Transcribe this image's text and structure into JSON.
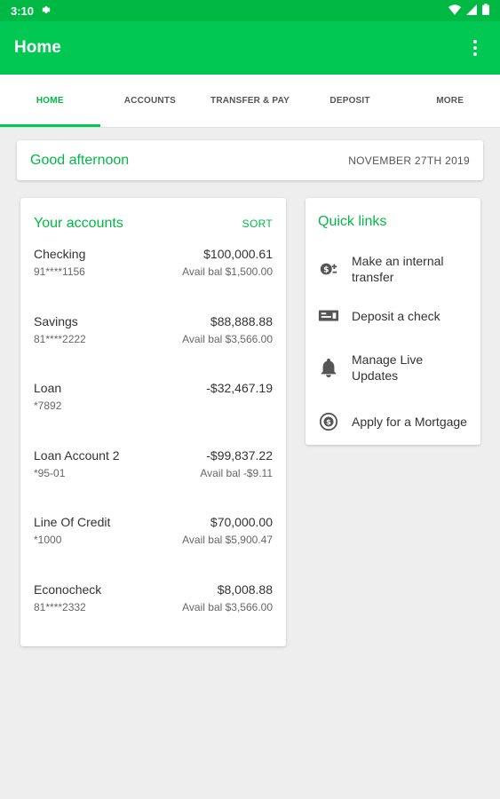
{
  "status_bar": {
    "time": "3:10"
  },
  "app_bar": {
    "title": "Home"
  },
  "tabs": [
    {
      "label": "HOME",
      "active": true
    },
    {
      "label": "ACCOUNTS"
    },
    {
      "label": "TRANSFER & PAY"
    },
    {
      "label": "DEPOSIT"
    },
    {
      "label": "MORE"
    }
  ],
  "greeting": {
    "text": "Good afternoon",
    "date": "NOVEMBER 27TH 2019"
  },
  "accounts": {
    "title": "Your accounts",
    "sort_label": "SORT",
    "items": [
      {
        "name": "Checking",
        "number": "91****1156",
        "balance": "$100,000.61",
        "available": "Avail bal $1,500.00"
      },
      {
        "name": "Savings",
        "number": "81****2222",
        "balance": "$88,888.88",
        "available": "Avail bal $3,566.00"
      },
      {
        "name": "Loan",
        "number": "*7892",
        "balance": "-$32,467.19",
        "available": ""
      },
      {
        "name": "Loan Account 2",
        "number": "*95-01",
        "balance": "-$99,837.22",
        "available": "Avail bal -$9.11"
      },
      {
        "name": "Line Of Credit",
        "number": "*1000",
        "balance": "$70,000.00",
        "available": "Avail bal $5,900.47"
      },
      {
        "name": "Econocheck",
        "number": "81****2332",
        "balance": "$8,008.88",
        "available": "Avail bal $3,566.00"
      }
    ]
  },
  "quick_links": {
    "title": "Quick links",
    "items": [
      {
        "label": "Make an internal transfer",
        "icon": "transfer-money-icon"
      },
      {
        "label": "Deposit a check",
        "icon": "check-deposit-icon"
      },
      {
        "label": "Manage Live Updates",
        "icon": "bell-icon"
      },
      {
        "label": "Apply for a Mortgage",
        "icon": "dollar-circle-icon"
      }
    ]
  },
  "colors": {
    "primary": "#00c853",
    "status_bar": "#00b945",
    "accent_text": "#00b945"
  }
}
